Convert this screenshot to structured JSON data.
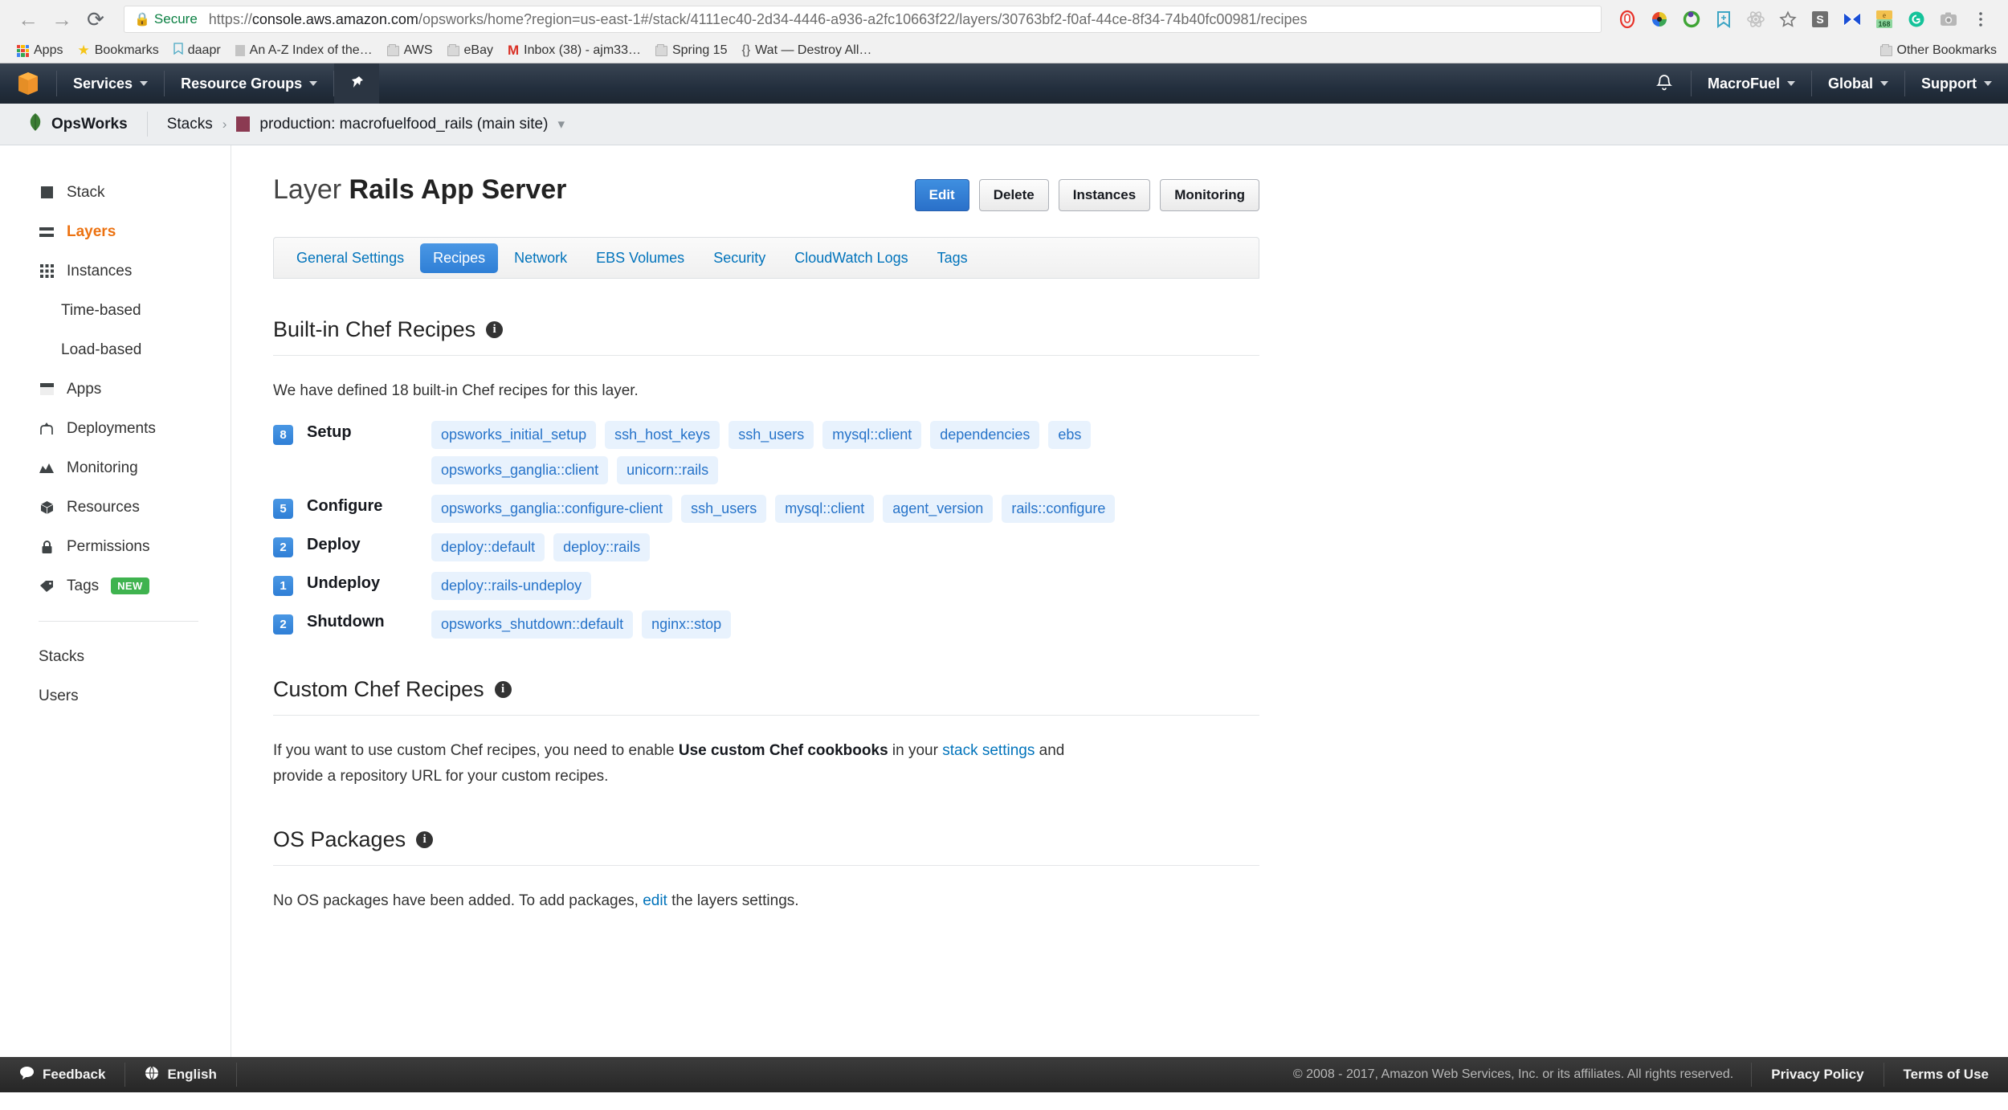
{
  "browser": {
    "back_icon": "back-arrow-icon",
    "forward_icon": "forward-arrow-icon",
    "reload_icon": "reload-icon",
    "secure_label": "Secure",
    "url_scheme": "https://",
    "url_host": "console.aws.amazon.com",
    "url_path": "/opsworks/home?region=us-east-1#/stack/4111ec40-2d34-4446-a936-a2fc10663f22/layers/30763bf2-f0af-44ce-8f34-74b40fc00981/recipes",
    "extension_icons": [
      "adblock-stop-icon",
      "colorzilla-eyedropper-icon",
      "clock-green-icon",
      "pocket-bookmark-icon",
      "react-devtools-icon",
      "star-bookmark-icon",
      "stylish-s-icon",
      "bowtie-icon",
      "pinterest-168-badge-icon",
      "grammarly-g-icon",
      "camera-screenshot-icon",
      "chrome-menu-icon"
    ],
    "bookmarks": [
      {
        "label": "Apps",
        "icon": "apps-grid-icon"
      },
      {
        "label": "Bookmarks",
        "icon": "star-icon"
      },
      {
        "label": "daapr",
        "icon": "bookmark-ribbon-icon"
      },
      {
        "label": "An A-Z Index of the…",
        "icon": "grey-square-icon"
      },
      {
        "label": "AWS",
        "icon": "folder-icon"
      },
      {
        "label": "eBay",
        "icon": "folder-icon"
      },
      {
        "label": "Inbox (38) - ajm33…",
        "icon": "gmail-m-icon"
      },
      {
        "label": "Spring 15",
        "icon": "folder-icon"
      },
      {
        "label": "Wat — Destroy All…",
        "icon": "braces-icon"
      }
    ],
    "other_bookmarks": "Other Bookmarks"
  },
  "aws_nav": {
    "logo_icon": "aws-cube-logo-icon",
    "services": "Services",
    "resource_groups": "Resource Groups",
    "pin_icon": "pin-icon",
    "bell_icon": "notification-bell-icon",
    "account": "MacroFuel",
    "region": "Global",
    "support": "Support"
  },
  "opsworks_bar": {
    "brand": "OpsWorks",
    "brand_icon": "opsworks-leaf-icon",
    "crumb_stacks": "Stacks",
    "crumb_arrow": "›",
    "stack_name": "production: macrofuelfood_rails (main site)",
    "stack_color": "#8b3a52"
  },
  "sidebar": {
    "items": [
      {
        "label": "Stack",
        "icon": "stack-square-icon",
        "active": false,
        "sub": false
      },
      {
        "label": "Layers",
        "icon": "layers-bars-icon",
        "active": true,
        "sub": false
      },
      {
        "label": "Instances",
        "icon": "instances-grid-icon",
        "active": false,
        "sub": false
      },
      {
        "label": "Time-based",
        "icon": "",
        "active": false,
        "sub": true
      },
      {
        "label": "Load-based",
        "icon": "",
        "active": false,
        "sub": true
      },
      {
        "label": "Apps",
        "icon": "apps-window-icon",
        "active": false,
        "sub": false
      },
      {
        "label": "Deployments",
        "icon": "deployments-merge-icon",
        "active": false,
        "sub": false
      },
      {
        "label": "Monitoring",
        "icon": "monitoring-chart-icon",
        "active": false,
        "sub": false
      },
      {
        "label": "Resources",
        "icon": "resources-cube-icon",
        "active": false,
        "sub": false
      },
      {
        "label": "Permissions",
        "icon": "lock-icon",
        "active": false,
        "sub": false
      },
      {
        "label": "Tags",
        "icon": "tag-icon",
        "active": false,
        "sub": false,
        "badge": "NEW"
      }
    ],
    "bottom_items": [
      {
        "label": "Stacks"
      },
      {
        "label": "Users"
      }
    ],
    "badge_color": "#3fb34f",
    "active_color": "#ec7211"
  },
  "main": {
    "title_prefix": "Layer",
    "title_name": "Rails App Server",
    "buttons": [
      {
        "label": "Edit",
        "primary": true
      },
      {
        "label": "Delete",
        "primary": false
      },
      {
        "label": "Instances",
        "primary": false
      },
      {
        "label": "Monitoring",
        "primary": false
      }
    ],
    "tabs": [
      {
        "label": "General Settings",
        "active": false
      },
      {
        "label": "Recipes",
        "active": true
      },
      {
        "label": "Network",
        "active": false
      },
      {
        "label": "EBS Volumes",
        "active": false
      },
      {
        "label": "Security",
        "active": false
      },
      {
        "label": "CloudWatch Logs",
        "active": false
      },
      {
        "label": "Tags",
        "active": false
      }
    ],
    "builtin": {
      "heading": "Built-in Chef Recipes",
      "info_icon": "info-icon",
      "description": "We have defined 18 built-in Chef recipes for this layer.",
      "rows": [
        {
          "count": "8",
          "label": "Setup",
          "recipes": [
            "opsworks_initial_setup",
            "ssh_host_keys",
            "ssh_users",
            "mysql::client",
            "dependencies",
            "ebs",
            "opsworks_ganglia::client",
            "unicorn::rails"
          ]
        },
        {
          "count": "5",
          "label": "Configure",
          "recipes": [
            "opsworks_ganglia::configure-client",
            "ssh_users",
            "mysql::client",
            "agent_version",
            "rails::configure"
          ]
        },
        {
          "count": "2",
          "label": "Deploy",
          "recipes": [
            "deploy::default",
            "deploy::rails"
          ]
        },
        {
          "count": "1",
          "label": "Undeploy",
          "recipes": [
            "deploy::rails-undeploy"
          ]
        },
        {
          "count": "2",
          "label": "Shutdown",
          "recipes": [
            "opsworks_shutdown::default",
            "nginx::stop"
          ]
        }
      ]
    },
    "custom": {
      "heading": "Custom Chef Recipes",
      "info_icon": "info-icon",
      "text_part1": "If you want to use custom Chef recipes, you need to enable ",
      "text_bold": "Use custom Chef cookbooks",
      "text_part2": " in your ",
      "link": "stack settings",
      "text_part3": " and provide a repository URL for your custom recipes."
    },
    "os_packages": {
      "heading": "OS Packages",
      "info_icon": "info-icon",
      "text_part1": "No OS packages have been added. To add packages, ",
      "link": "edit",
      "text_part2": " the layers settings."
    }
  },
  "footer": {
    "feedback": "Feedback",
    "feedback_icon": "speech-bubble-icon",
    "language": "English",
    "language_icon": "globe-icon",
    "copyright": "© 2008 - 2017, Amazon Web Services, Inc. or its affiliates. All rights reserved.",
    "privacy": "Privacy Policy",
    "terms": "Terms of Use"
  }
}
